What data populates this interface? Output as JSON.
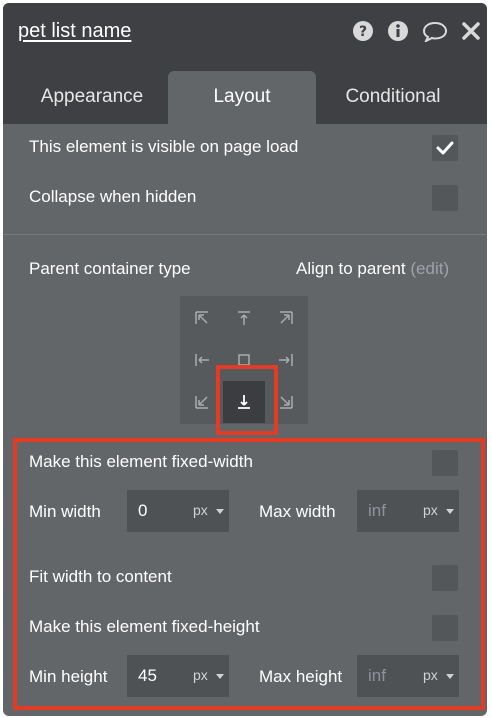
{
  "header": {
    "title": "pet list name",
    "icons": [
      "help-icon",
      "info-icon",
      "comment-icon",
      "close-icon"
    ]
  },
  "tabs": [
    {
      "label": "Appearance",
      "active": false
    },
    {
      "label": "Layout",
      "active": true
    },
    {
      "label": "Conditional",
      "active": false
    }
  ],
  "visibility": {
    "visible_on_load_label": "This element is visible on page load",
    "visible_on_load_checked": true,
    "collapse_when_hidden_label": "Collapse when hidden",
    "collapse_when_hidden_checked": false
  },
  "container": {
    "parent_type_label": "Parent container type",
    "parent_type_value": "Align to parent",
    "edit_link": "(edit)",
    "alignment_selected": "bottom-center"
  },
  "sizing": {
    "fixed_width_label": "Make this element fixed-width",
    "fixed_width_checked": false,
    "min_width_label": "Min width",
    "min_width_value": "0",
    "min_width_unit": "px",
    "max_width_label": "Max width",
    "max_width_placeholder": "inf",
    "max_width_unit": "px",
    "fit_width_label": "Fit width to content",
    "fit_width_checked": false,
    "fixed_height_label": "Make this element fixed-height",
    "fixed_height_checked": false,
    "min_height_label": "Min height",
    "min_height_value": "45",
    "min_height_unit": "px",
    "max_height_label": "Max height",
    "max_height_placeholder": "inf",
    "max_height_unit": "px"
  },
  "colors": {
    "panel": "#636669",
    "header": "#3e4043",
    "highlight": "#e43b25"
  }
}
